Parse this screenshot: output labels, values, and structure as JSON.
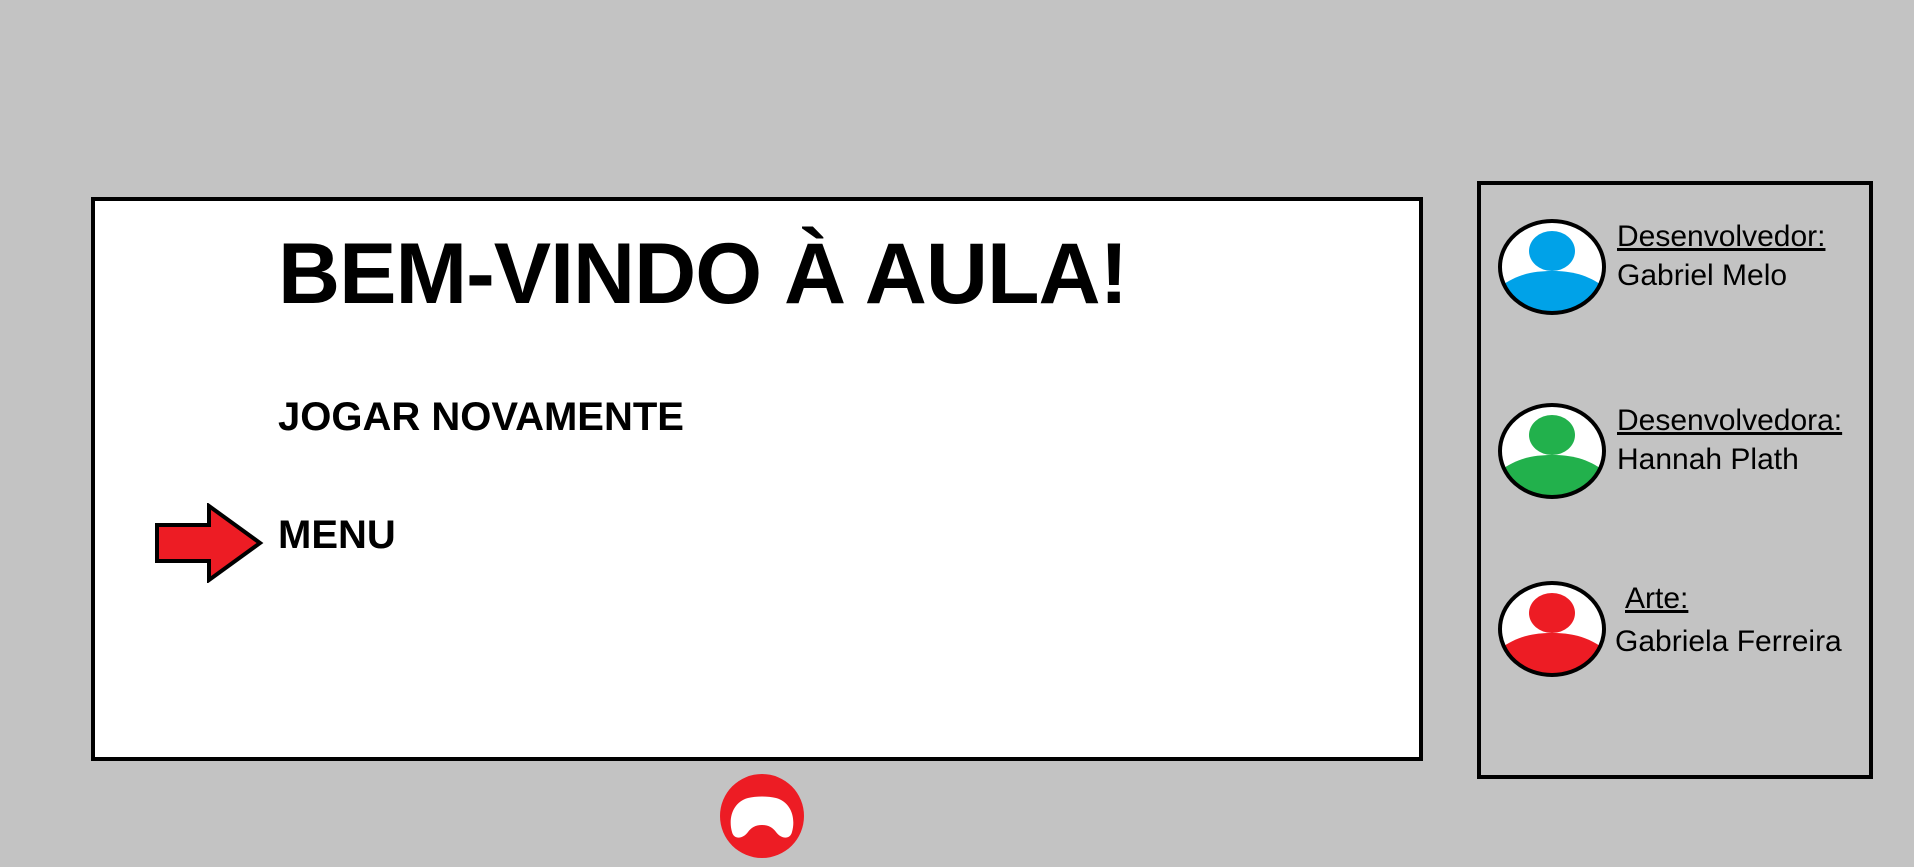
{
  "main": {
    "title": "BEM-VINDO À AULA!",
    "options": [
      {
        "label": "JOGAR NOVAMENTE"
      },
      {
        "label": "MENU",
        "selected": true
      }
    ]
  },
  "credits": [
    {
      "role": "Desenvolvedor:",
      "name": "Gabriel Melo",
      "color": "#00a2e8"
    },
    {
      "role": "Desenvolvedora:",
      "name": "Hannah Plath",
      "color": "#22b14c"
    },
    {
      "role": "Arte:",
      "name": "Gabriela Ferreira",
      "color": "#ed1c24"
    }
  ],
  "colors": {
    "background": "#c3c3c3",
    "arrow": "#ed1c24",
    "controller": "#ed1c24"
  },
  "icons": {
    "selector": "arrow-right-icon",
    "controller": "gamepad-icon",
    "avatar": "user-avatar-icon"
  }
}
